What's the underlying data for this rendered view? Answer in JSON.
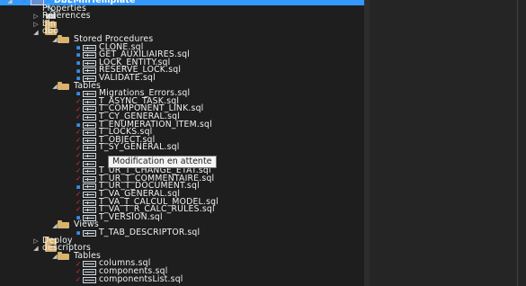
{
  "tooltip": "Modification en attente",
  "colors": {
    "selection": "#3399ff",
    "pending_check": "#e0323a",
    "lock": "#3a8ee6",
    "folder": "#d9b36c"
  },
  "tree": [
    {
      "label": "DbEMinTemplate",
      "level": 0,
      "expander": "open",
      "icon": "project",
      "mark": "lock",
      "selected": true
    },
    {
      "label": "Properties",
      "level": 1,
      "expander": "none",
      "icon": "wrench",
      "mark": ""
    },
    {
      "label": "Références",
      "level": 1,
      "expander": "closed",
      "icon": "refs",
      "mark": ""
    },
    {
      "label": "bin",
      "level": 1,
      "expander": "closed",
      "icon": "folder",
      "mark": ""
    },
    {
      "label": "dbo",
      "level": 1,
      "expander": "open",
      "icon": "folder",
      "mark": ""
    },
    {
      "label": "Stored Procedures",
      "level": 2,
      "expander": "open",
      "icon": "folder",
      "mark": ""
    },
    {
      "label": "CLONE.sql",
      "level": 3,
      "expander": "none",
      "icon": "sql",
      "mark": "lock"
    },
    {
      "label": "GET_AUXILIAIRES.sql",
      "level": 3,
      "expander": "none",
      "icon": "sql",
      "mark": "lock"
    },
    {
      "label": "LOCK_ENTITY.sql",
      "level": 3,
      "expander": "none",
      "icon": "sql",
      "mark": "lock"
    },
    {
      "label": "RESERVE_LOCK.sql",
      "level": 3,
      "expander": "none",
      "icon": "sql",
      "mark": "lock"
    },
    {
      "label": "VALIDATE.sql",
      "level": 3,
      "expander": "none",
      "icon": "sql",
      "mark": "lock"
    },
    {
      "label": "Tables",
      "level": 2,
      "expander": "open",
      "icon": "folder",
      "mark": ""
    },
    {
      "label": "Migrations_Errors.sql",
      "level": 3,
      "expander": "none",
      "icon": "sql",
      "mark": "lock"
    },
    {
      "label": "T_ASYNC_TASK.sql",
      "level": 3,
      "expander": "none",
      "icon": "sql",
      "mark": "check"
    },
    {
      "label": "T_COMPONENT_LINK.sql",
      "level": 3,
      "expander": "none",
      "icon": "sql",
      "mark": "check"
    },
    {
      "label": "T_CY_GENERAL.sql",
      "level": 3,
      "expander": "none",
      "icon": "sql",
      "mark": "check"
    },
    {
      "label": "T_ENUMERATION_ITEM.sql",
      "level": 3,
      "expander": "none",
      "icon": "sql",
      "mark": "lock"
    },
    {
      "label": "T_LOCKS.sql",
      "level": 3,
      "expander": "none",
      "icon": "sql",
      "mark": "check"
    },
    {
      "label": "T_OBJECT.sql",
      "level": 3,
      "expander": "none",
      "icon": "sql",
      "mark": "check"
    },
    {
      "label": "T_SY_GENERAL.sql",
      "level": 3,
      "expander": "none",
      "icon": "sql",
      "mark": "check"
    },
    {
      "label": "",
      "level": 3,
      "expander": "none",
      "icon": "sql",
      "mark": "check"
    },
    {
      "label": "",
      "level": 3,
      "expander": "none",
      "icon": "sql",
      "mark": "check"
    },
    {
      "label": "T_UR_T_CHANGE_ETAT.sql",
      "level": 3,
      "expander": "none",
      "icon": "sql",
      "mark": "check"
    },
    {
      "label": "T_UR_T_COMMENTAIRE.sql",
      "level": 3,
      "expander": "none",
      "icon": "sql",
      "mark": "check"
    },
    {
      "label": "T_UR_T_DOCUMENT.sql",
      "level": 3,
      "expander": "none",
      "icon": "sql",
      "mark": "lock"
    },
    {
      "label": "T_VA_GENERAL.sql",
      "level": 3,
      "expander": "none",
      "icon": "sql",
      "mark": "check"
    },
    {
      "label": "T_VA_T_CALCUL_MODEL.sql",
      "level": 3,
      "expander": "none",
      "icon": "sql",
      "mark": "check"
    },
    {
      "label": "T_VA_T_R_CALC_RULES.sql",
      "level": 3,
      "expander": "none",
      "icon": "sql",
      "mark": "check"
    },
    {
      "label": "T_VERSION.sql",
      "level": 3,
      "expander": "none",
      "icon": "sql",
      "mark": "lock"
    },
    {
      "label": "Views",
      "level": 2,
      "expander": "open",
      "icon": "folder",
      "mark": ""
    },
    {
      "label": "T_TAB_DESCRIPTOR.sql",
      "level": 3,
      "expander": "none",
      "icon": "sql",
      "mark": "lock"
    },
    {
      "label": "Deploy",
      "level": 1,
      "expander": "closed",
      "icon": "folder",
      "mark": ""
    },
    {
      "label": "descriptors",
      "level": 1,
      "expander": "open",
      "icon": "folder",
      "mark": ""
    },
    {
      "label": "Tables",
      "level": 2,
      "expander": "open",
      "icon": "folder",
      "mark": ""
    },
    {
      "label": "columns.sql",
      "level": 3,
      "expander": "none",
      "icon": "json",
      "mark": "check"
    },
    {
      "label": "components.sql",
      "level": 3,
      "expander": "none",
      "icon": "json",
      "mark": "check"
    },
    {
      "label": "componentsList.sql",
      "level": 3,
      "expander": "none",
      "icon": "json",
      "mark": "check"
    }
  ]
}
